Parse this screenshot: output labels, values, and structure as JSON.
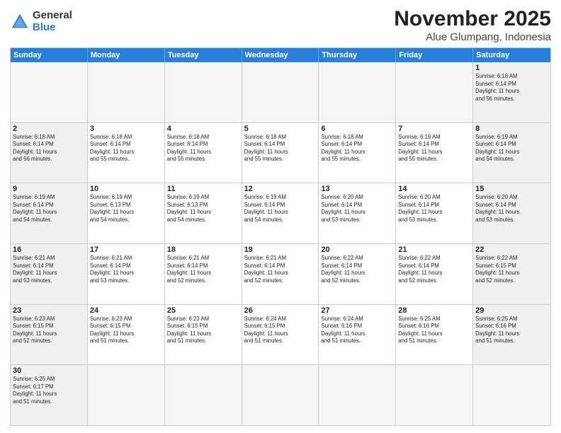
{
  "header": {
    "logo_general": "General",
    "logo_blue": "Blue",
    "month_year": "November 2025",
    "location": "Alue Glumpang, Indonesia"
  },
  "days_of_week": [
    "Sunday",
    "Monday",
    "Tuesday",
    "Wednesday",
    "Thursday",
    "Friday",
    "Saturday"
  ],
  "weeks": [
    [
      {
        "day": "",
        "info": ""
      },
      {
        "day": "",
        "info": ""
      },
      {
        "day": "",
        "info": ""
      },
      {
        "day": "",
        "info": ""
      },
      {
        "day": "",
        "info": ""
      },
      {
        "day": "",
        "info": ""
      },
      {
        "day": "1",
        "info": "Sunrise: 6:18 AM\nSunset: 6:14 PM\nDaylight: 11 hours\nand 56 minutes."
      }
    ],
    [
      {
        "day": "2",
        "info": "Sunrise: 6:18 AM\nSunset: 6:14 PM\nDaylight: 11 hours\nand 56 minutes."
      },
      {
        "day": "3",
        "info": "Sunrise: 6:18 AM\nSunset: 6:14 PM\nDaylight: 11 hours\nand 55 minutes."
      },
      {
        "day": "4",
        "info": "Sunrise: 6:18 AM\nSunset: 6:14 PM\nDaylight: 11 hours\nand 55 minutes."
      },
      {
        "day": "5",
        "info": "Sunrise: 6:18 AM\nSunset: 6:14 PM\nDaylight: 11 hours\nand 55 minutes."
      },
      {
        "day": "6",
        "info": "Sunrise: 6:18 AM\nSunset: 6:14 PM\nDaylight: 11 hours\nand 55 minutes."
      },
      {
        "day": "7",
        "info": "Sunrise: 6:19 AM\nSunset: 6:14 PM\nDaylight: 11 hours\nand 55 minutes."
      },
      {
        "day": "8",
        "info": "Sunrise: 6:19 AM\nSunset: 6:14 PM\nDaylight: 11 hours\nand 54 minutes."
      }
    ],
    [
      {
        "day": "9",
        "info": "Sunrise: 6:19 AM\nSunset: 6:14 PM\nDaylight: 11 hours\nand 54 minutes."
      },
      {
        "day": "10",
        "info": "Sunrise: 6:19 AM\nSunset: 6:13 PM\nDaylight: 11 hours\nand 54 minutes."
      },
      {
        "day": "11",
        "info": "Sunrise: 6:19 AM\nSunset: 6:13 PM\nDaylight: 11 hours\nand 54 minutes."
      },
      {
        "day": "12",
        "info": "Sunrise: 6:19 AM\nSunset: 6:14 PM\nDaylight: 11 hours\nand 54 minutes."
      },
      {
        "day": "13",
        "info": "Sunrise: 6:20 AM\nSunset: 6:14 PM\nDaylight: 11 hours\nand 53 minutes."
      },
      {
        "day": "14",
        "info": "Sunrise: 6:20 AM\nSunset: 6:14 PM\nDaylight: 11 hours\nand 53 minutes."
      },
      {
        "day": "15",
        "info": "Sunrise: 6:20 AM\nSunset: 6:14 PM\nDaylight: 11 hours\nand 53 minutes."
      }
    ],
    [
      {
        "day": "16",
        "info": "Sunrise: 6:21 AM\nSunset: 6:14 PM\nDaylight: 11 hours\nand 53 minutes."
      },
      {
        "day": "17",
        "info": "Sunrise: 6:21 AM\nSunset: 6:14 PM\nDaylight: 11 hours\nand 53 minutes."
      },
      {
        "day": "18",
        "info": "Sunrise: 6:21 AM\nSunset: 6:14 PM\nDaylight: 11 hours\nand 52 minutes."
      },
      {
        "day": "19",
        "info": "Sunrise: 6:21 AM\nSunset: 6:14 PM\nDaylight: 11 hours\nand 52 minutes."
      },
      {
        "day": "20",
        "info": "Sunrise: 6:22 AM\nSunset: 6:14 PM\nDaylight: 11 hours\nand 52 minutes."
      },
      {
        "day": "21",
        "info": "Sunrise: 6:22 AM\nSunset: 6:14 PM\nDaylight: 11 hours\nand 52 minutes."
      },
      {
        "day": "22",
        "info": "Sunrise: 6:22 AM\nSunset: 6:15 PM\nDaylight: 11 hours\nand 52 minutes."
      }
    ],
    [
      {
        "day": "23",
        "info": "Sunrise: 6:23 AM\nSunset: 6:15 PM\nDaylight: 11 hours\nand 52 minutes."
      },
      {
        "day": "24",
        "info": "Sunrise: 6:23 AM\nSunset: 6:15 PM\nDaylight: 11 hours\nand 51 minutes."
      },
      {
        "day": "25",
        "info": "Sunrise: 6:23 AM\nSunset: 6:15 PM\nDaylight: 11 hours\nand 51 minutes."
      },
      {
        "day": "26",
        "info": "Sunrise: 6:24 AM\nSunset: 6:15 PM\nDaylight: 11 hours\nand 51 minutes."
      },
      {
        "day": "27",
        "info": "Sunrise: 6:24 AM\nSunset: 6:16 PM\nDaylight: 11 hours\nand 51 minutes."
      },
      {
        "day": "28",
        "info": "Sunrise: 6:25 AM\nSunset: 6:16 PM\nDaylight: 11 hours\nand 51 minutes."
      },
      {
        "day": "29",
        "info": "Sunrise: 6:25 AM\nSunset: 6:16 PM\nDaylight: 11 hours\nand 51 minutes."
      }
    ],
    [
      {
        "day": "30",
        "info": "Sunrise: 6:25 AM\nSunset: 6:17 PM\nDaylight: 11 hours\nand 51 minutes."
      },
      {
        "day": "",
        "info": ""
      },
      {
        "day": "",
        "info": ""
      },
      {
        "day": "",
        "info": ""
      },
      {
        "day": "",
        "info": ""
      },
      {
        "day": "",
        "info": ""
      },
      {
        "day": "",
        "info": ""
      }
    ]
  ]
}
